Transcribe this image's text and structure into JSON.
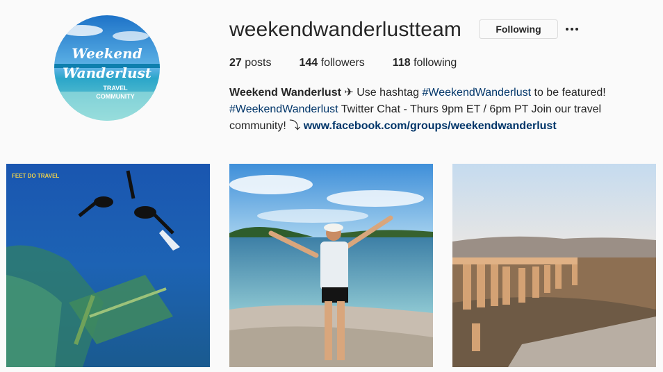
{
  "profile": {
    "username": "weekendwanderlustteam",
    "follow_label": "Following",
    "more_icon": "more-horizontal-icon",
    "avatar": {
      "line1": "Weekend",
      "line2": "Wanderlust",
      "line3": "TRAVEL",
      "line4": "COMMUNITY"
    }
  },
  "stats": {
    "posts_count": "27",
    "posts_label": "posts",
    "followers_count": "144",
    "followers_label": "followers",
    "following_count": "118",
    "following_label": "following"
  },
  "bio": {
    "name": "Weekend Wanderlust",
    "plane": "✈",
    "text1": "Use hashtag",
    "hashtag1": "#WeekendWanderlust",
    "text2": "to be featured!",
    "hashtag2": "#WeekendWanderlust",
    "text3": "Twitter Chat - Thurs 9pm ET / 6pm PT Join our travel community!",
    "arrow": "⤵",
    "link": "www.facebook.com/groups/weekendwanderlust"
  },
  "posts": [
    {
      "watermark": "FEET DO TRAVEL"
    },
    {
      "watermark": ""
    },
    {
      "watermark": ""
    }
  ],
  "colors": {
    "link": "#003569",
    "text": "#262626",
    "background": "#fafafa",
    "border": "#dbdbdb"
  }
}
